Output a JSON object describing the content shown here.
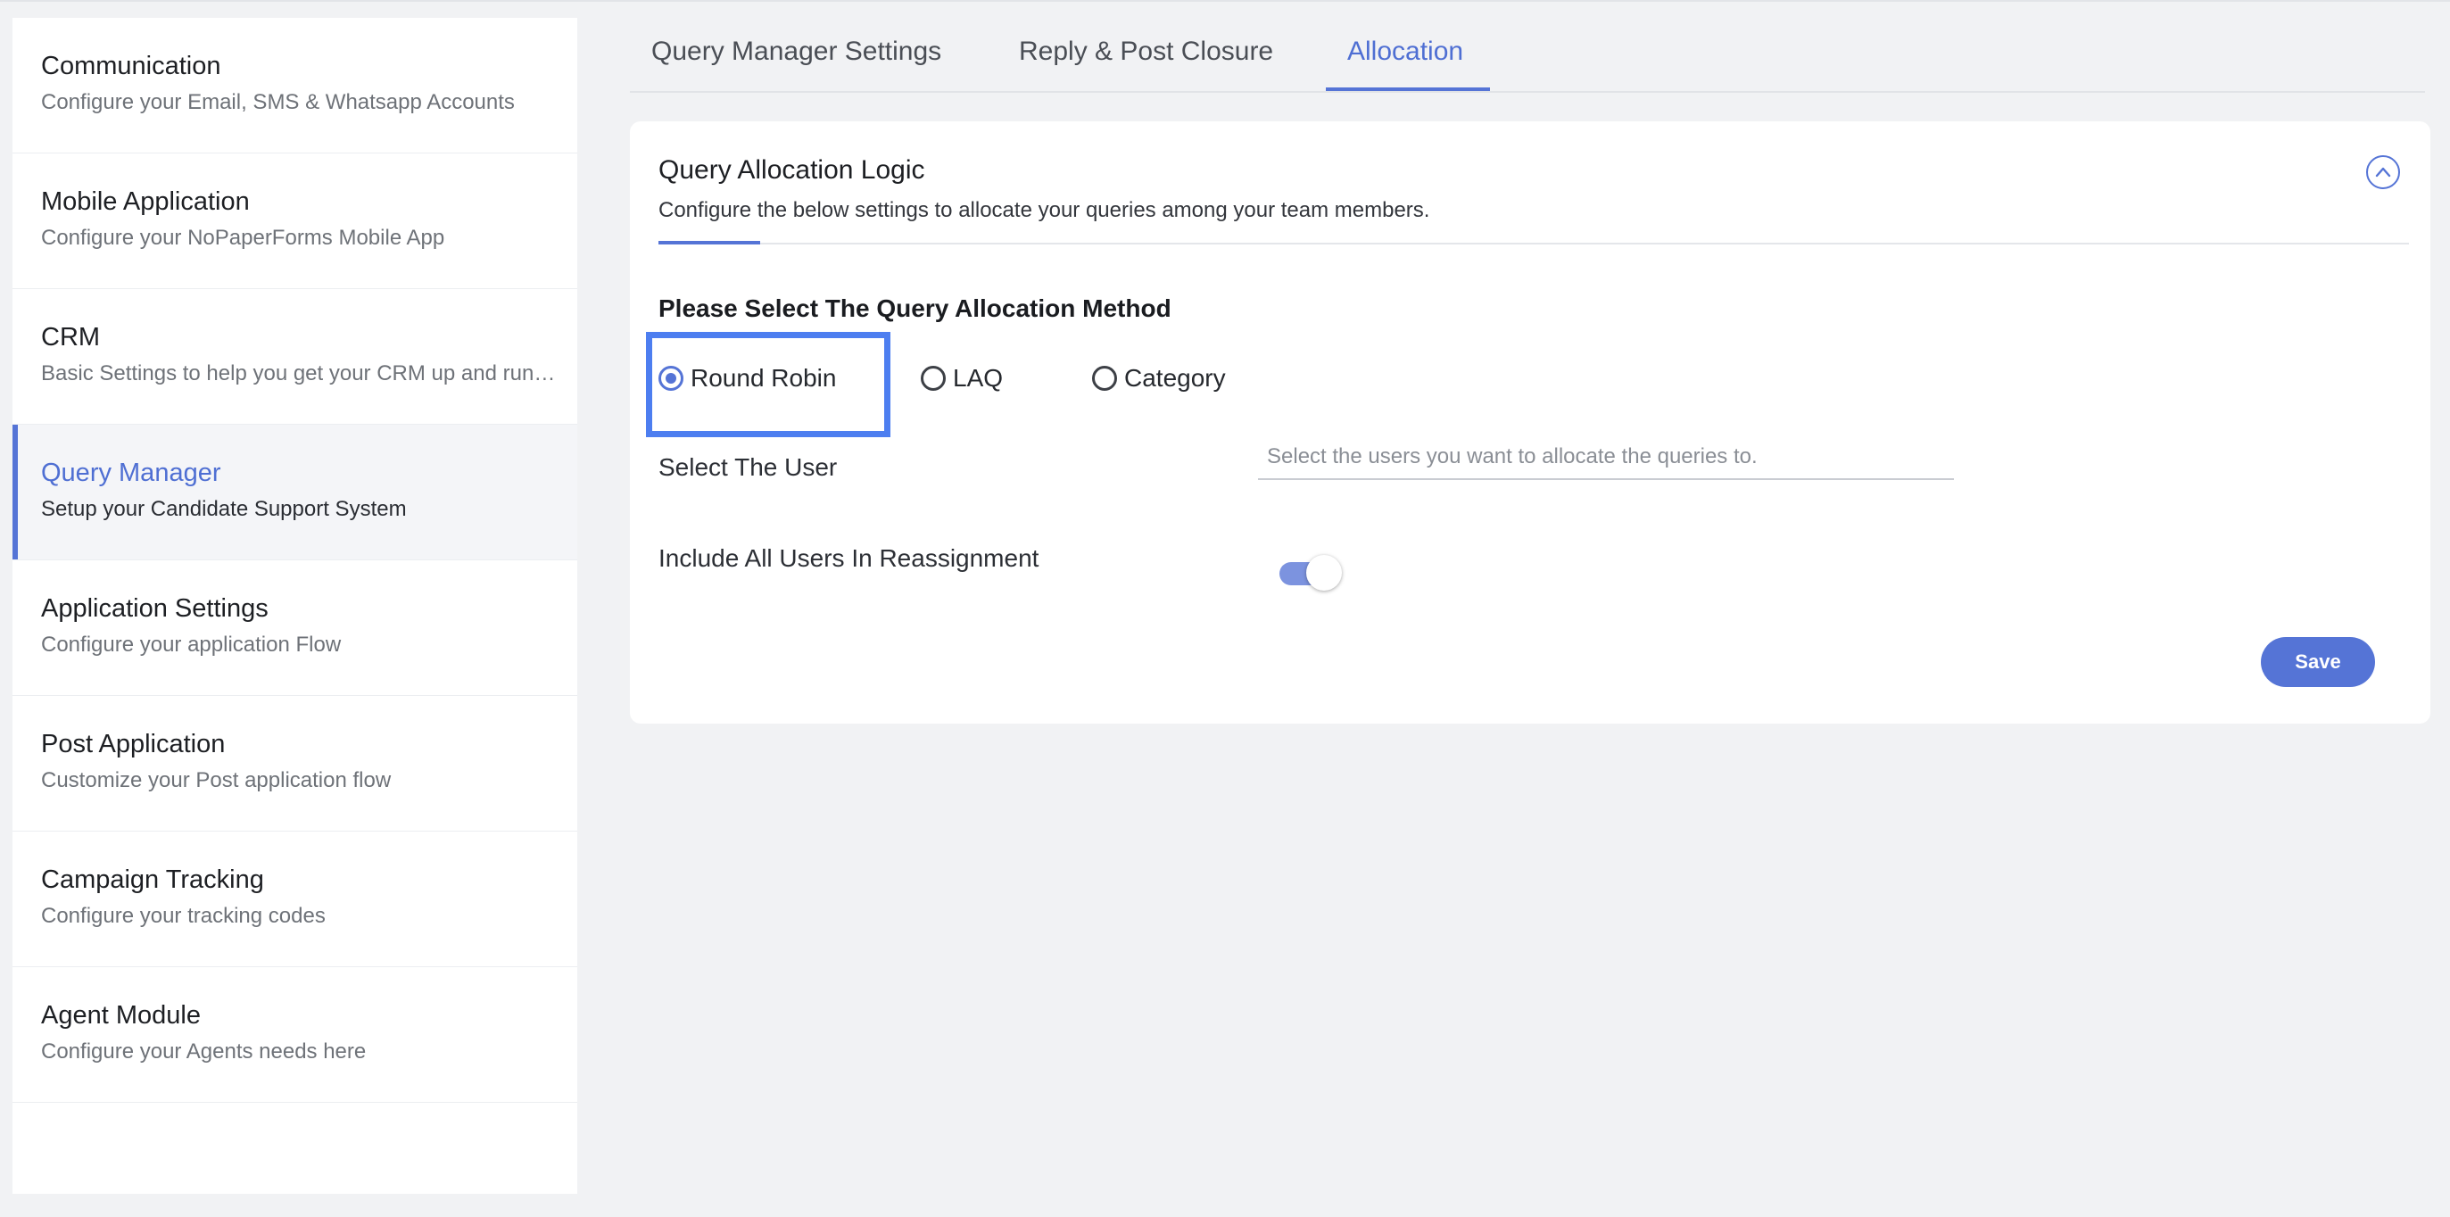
{
  "sidebar": {
    "items": [
      {
        "title": "Communication",
        "desc": "Configure your Email, SMS & Whatsapp Accounts",
        "active": false
      },
      {
        "title": "Mobile Application",
        "desc": "Configure your NoPaperForms Mobile App",
        "active": false
      },
      {
        "title": "CRM",
        "desc": "Basic Settings to help you get your CRM up and runn...",
        "active": false
      },
      {
        "title": "Query Manager",
        "desc": "Setup your Candidate Support System",
        "active": true
      },
      {
        "title": "Application Settings",
        "desc": "Configure your application Flow",
        "active": false
      },
      {
        "title": "Post Application",
        "desc": "Customize your Post application flow",
        "active": false
      },
      {
        "title": "Campaign Tracking",
        "desc": "Configure your tracking codes",
        "active": false
      },
      {
        "title": "Agent Module",
        "desc": "Configure your Agents needs here",
        "active": false
      }
    ]
  },
  "tabs": [
    {
      "label": "Query Manager Settings",
      "active": false
    },
    {
      "label": "Reply & Post Closure",
      "active": false
    },
    {
      "label": "Allocation",
      "active": true
    }
  ],
  "card": {
    "title": "Query Allocation Logic",
    "subtitle": "Configure the below settings to allocate your queries among your team members.",
    "collapse_icon": "chevron-up-icon",
    "method_heading": "Please Select The Query Allocation Method",
    "methods": [
      {
        "label": "Round Robin",
        "checked": true
      },
      {
        "label": "LAQ",
        "checked": false
      },
      {
        "label": "Category",
        "checked": false
      }
    ],
    "select_user_label": "Select The User",
    "select_user_placeholder": "Select the users you want to allocate the queries to.",
    "select_user_value": "",
    "reassign_label": "Include All Users In Reassignment",
    "reassign_enabled": true,
    "save_label": "Save"
  },
  "colors": {
    "accent": "#5574d6",
    "highlight": "#4d7ef0",
    "background": "#f1f2f4"
  }
}
